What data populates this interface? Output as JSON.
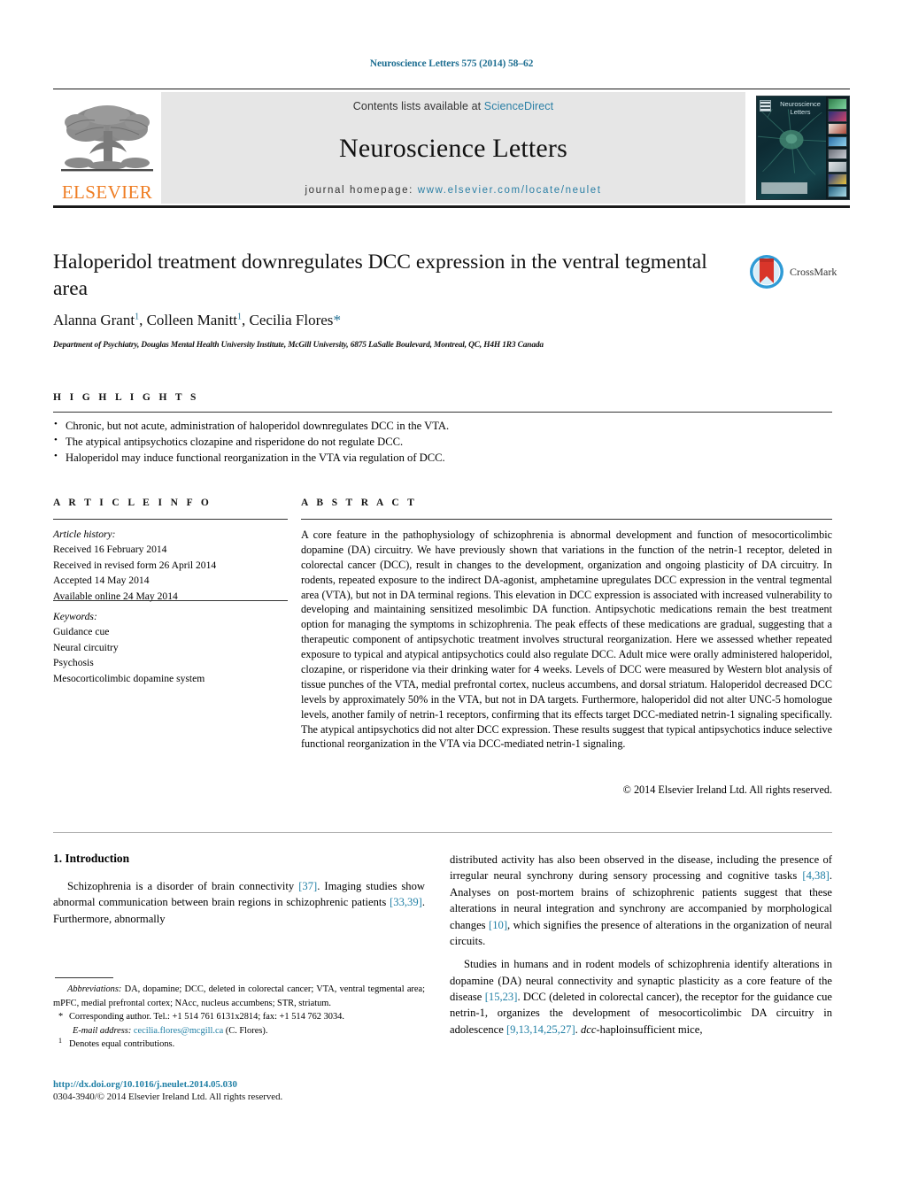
{
  "running_head": "Neuroscience Letters 575 (2014) 58–62",
  "masthead": {
    "publisher_logo_text": "ELSEVIER",
    "contents_prefix": "Contents lists available at ",
    "contents_link": "ScienceDirect",
    "journal_title": "Neuroscience Letters",
    "homepage_prefix": "journal homepage: ",
    "homepage_url": "www.elsevier.com/locate/neulet",
    "cover_title": "Neuroscience Letters"
  },
  "article": {
    "title": "Haloperidol treatment downregulates DCC expression in the ventral tegmental area",
    "crossmark_label": "CrossMark",
    "authors_html": "Alanna Grant<sup>1</sup>, Colleen Manitt<sup>1</sup>, Cecilia Flores<span class=\"star\">*</span>",
    "affiliation": "Department of Psychiatry, Douglas Mental Health University Institute, McGill University, 6875 LaSalle Boulevard, Montreal, QC, H4H 1R3 Canada"
  },
  "highlights": {
    "label": "H I G H L I G H T S",
    "items": [
      "Chronic, but not acute, administration of haloperidol downregulates DCC in the VTA.",
      "The atypical antipsychotics clozapine and risperidone do not regulate DCC.",
      "Haloperidol may induce functional reorganization in the VTA via regulation of DCC."
    ]
  },
  "article_info": {
    "label": "A R T I C L E     I N F O",
    "history_label": "Article history:",
    "history": [
      "Received 16 February 2014",
      "Received in revised form 26 April 2014",
      "Accepted 14 May 2014",
      "Available online 24 May 2014"
    ],
    "keywords_label": "Keywords:",
    "keywords": [
      "Guidance cue",
      "Neural circuitry",
      "Psychosis",
      "Mesocorticolimbic dopamine system"
    ]
  },
  "abstract": {
    "label": "A B S T R A C T",
    "text": "A core feature in the pathophysiology of schizophrenia is abnormal development and function of mesocorticolimbic dopamine (DA) circuitry. We have previously shown that variations in the function of the netrin-1 receptor, deleted in colorectal cancer (DCC), result in changes to the development, organization and ongoing plasticity of DA circuitry. In rodents, repeated exposure to the indirect DA-agonist, amphetamine upregulates DCC expression in the ventral tegmental area (VTA), but not in DA terminal regions. This elevation in DCC expression is associated with increased vulnerability to developing and maintaining sensitized mesolimbic DA function. Antipsychotic medications remain the best treatment option for managing the symptoms in schizophrenia. The peak effects of these medications are gradual, suggesting that a therapeutic component of antipsychotic treatment involves structural reorganization. Here we assessed whether repeated exposure to typical and atypical antipsychotics could also regulate DCC. Adult mice were orally administered haloperidol, clozapine, or risperidone via their drinking water for 4 weeks. Levels of DCC were measured by Western blot analysis of tissue punches of the VTA, medial prefrontal cortex, nucleus accumbens, and dorsal striatum. Haloperidol decreased DCC levels by approximately 50% in the VTA, but not in DA targets. Furthermore, haloperidol did not alter UNC-5 homologue levels, another family of netrin-1 receptors, confirming that its effects target DCC-mediated netrin-1 signaling specifically. The atypical antipsychotics did not alter DCC expression. These results suggest that typical antipsychotics induce selective functional reorganization in the VTA via DCC-mediated netrin-1 signaling.",
    "copyright": "© 2014 Elsevier Ireland Ltd. All rights reserved."
  },
  "body": {
    "section_heading": "1. Introduction",
    "left_paragraph_html": "Schizophrenia is a disorder of brain connectivity <span class=\"cite\">[37]</span>. Imaging studies show abnormal communication between brain regions in schizophrenic patients <span class=\"cite\">[33,39]</span>. Furthermore, abnormally",
    "right_paragraph_1_html": "distributed activity has also been observed in the disease, including the presence of irregular neural synchrony during sensory processing and cognitive tasks <span class=\"cite\">[4,38]</span>. Analyses on post-mortem brains of schizophrenic patients suggest that these alterations in neural integration and synchrony are accompanied by morphological changes <span class=\"cite\">[10]</span>, which signifies the presence of alterations in the organization of neural circuits.",
    "right_paragraph_2_html": "Studies in humans and in rodent models of schizophrenia identify alterations in dopamine (DA) neural connectivity and synaptic plasticity as a core feature of the disease <span class=\"cite\">[15,23]</span>. DCC (deleted in colorectal cancer), the receptor for the guidance cue netrin-1, organizes the development of mesocorticolimbic DA circuitry in adolescence <span class=\"cite\">[9,13,14,25,27]</span>. <span style=\"font-style:italic\">dcc</span>-haploinsufficient mice,"
  },
  "footnotes": {
    "abbreviations_html": "<span class=\"it\">Abbreviations:</span> DA, dopamine; DCC, deleted in colorectal cancer; VTA, ventral tegmental area; mPFC, medial prefrontal cortex; NAcc, nucleus accumbens; STR, striatum.",
    "corresponding_html": "Corresponding author. Tel.: +1 514 761 6131x2814; fax: +1 514 762 3034.",
    "email_html": "<span class=\"it\">E-mail address:</span> <span class=\"mail\">cecilia.flores@mcgill.ca</span> (C. Flores).",
    "equal_contrib": "Denotes equal contributions.",
    "corresponding_mark": "*",
    "equal_mark": "1"
  },
  "footer": {
    "doi": "http://dx.doi.org/10.1016/j.neulet.2014.05.030",
    "issn_copyright": "0304-3940/© 2014 Elsevier Ireland Ltd. All rights reserved."
  },
  "colors": {
    "link": "#1f7fa5",
    "header_blue": "#1f6f92",
    "elsevier_orange": "#ef7d23",
    "band_gray": "#e6e6e6",
    "cover_dark": "#123037"
  }
}
